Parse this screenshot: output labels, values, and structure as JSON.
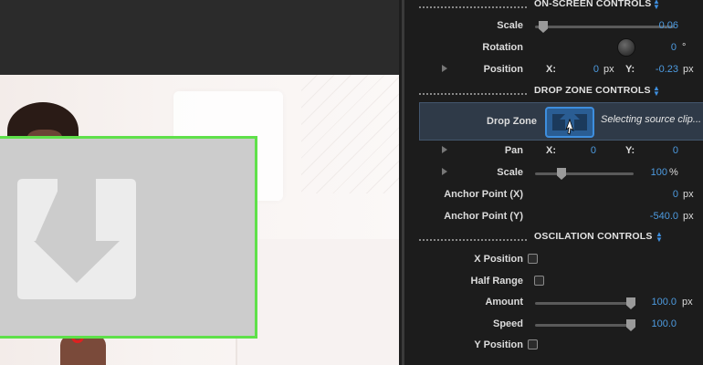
{
  "viewer": {
    "dropzone_border_color": "#5fe04a"
  },
  "sections": {
    "onscreen": {
      "title": "ON-SCREEN CONTROLS"
    },
    "dropzone": {
      "title": "DROP ZONE CONTROLS"
    },
    "oscillation": {
      "title": "OSCILATION CONTROLS"
    }
  },
  "onscreen": {
    "scale": {
      "label": "Scale",
      "value": "0.06"
    },
    "rotation": {
      "label": "Rotation",
      "value": "0",
      "unit": "°"
    },
    "position": {
      "label": "Position",
      "x_label": "X:",
      "x_value": "0",
      "x_unit": "px",
      "y_label": "Y:",
      "y_value": "-0.23",
      "y_unit": "px"
    }
  },
  "dropzone": {
    "drop_zone": {
      "label": "Drop Zone",
      "status": "Selecting source clip..."
    },
    "pan": {
      "label": "Pan",
      "x_label": "X:",
      "x_value": "0",
      "y_label": "Y:",
      "y_value": "0"
    },
    "scale": {
      "label": "Scale",
      "value": "100",
      "unit": "%"
    },
    "anchor_x": {
      "label": "Anchor Point (X)",
      "value": "0",
      "unit": "px"
    },
    "anchor_y": {
      "label": "Anchor Point (Y)",
      "value": "-540.0",
      "unit": "px"
    }
  },
  "oscillation": {
    "x_position": {
      "label": "X Position"
    },
    "half_range": {
      "label": "Half Range"
    },
    "amount": {
      "label": "Amount",
      "value": "100.0",
      "unit": "px"
    },
    "speed": {
      "label": "Speed",
      "value": "100.0"
    },
    "y_position": {
      "label": "Y Position"
    }
  },
  "colors": {
    "accent": "#3e8ede",
    "value_text": "#4d9be0"
  }
}
